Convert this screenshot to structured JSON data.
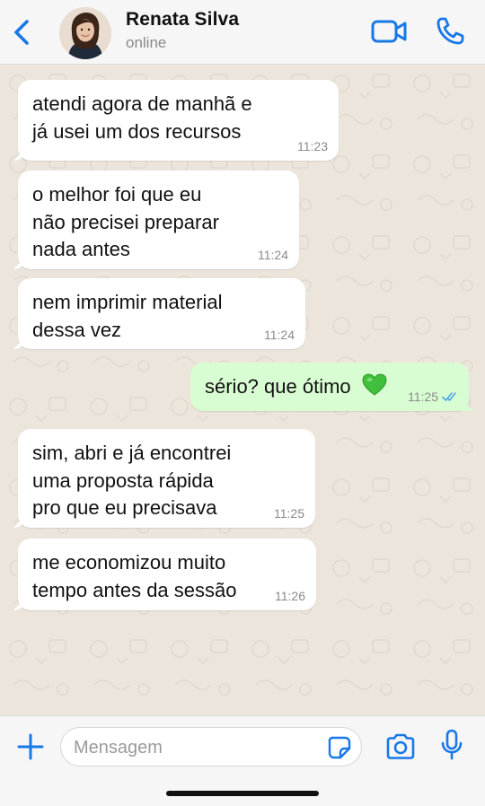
{
  "header": {
    "contact_name": "Renata Silva",
    "status": "online",
    "accent_color": "#1878e8"
  },
  "messages": [
    {
      "direction": "incoming",
      "text": "atendi agora de manhã e\njá usei um dos recursos",
      "time": "11:23"
    },
    {
      "direction": "incoming",
      "text": "o melhor foi que eu\nnão precisei preparar\nnada antes",
      "time": "11:24"
    },
    {
      "direction": "incoming",
      "text": "nem imprimir material\ndessa vez",
      "time": "11:24"
    },
    {
      "direction": "outgoing",
      "text": "sério? que ótimo",
      "emoji": "green-heart",
      "time": "11:25",
      "read": true
    },
    {
      "direction": "incoming",
      "text": "sim, abri e já encontrei\numa proposta rápida\npro que eu precisava",
      "time": "11:25"
    },
    {
      "direction": "incoming",
      "text": "me economizou muito\ntempo antes da sessão",
      "time": "11:26"
    }
  ],
  "composer": {
    "placeholder": "Mensagem",
    "value": ""
  },
  "icons": {
    "back": "chevron-left-icon",
    "video": "video-camera-icon",
    "call": "phone-icon",
    "add": "plus-icon",
    "sticker": "sticker-icon",
    "camera": "camera-icon",
    "mic": "microphone-icon"
  }
}
